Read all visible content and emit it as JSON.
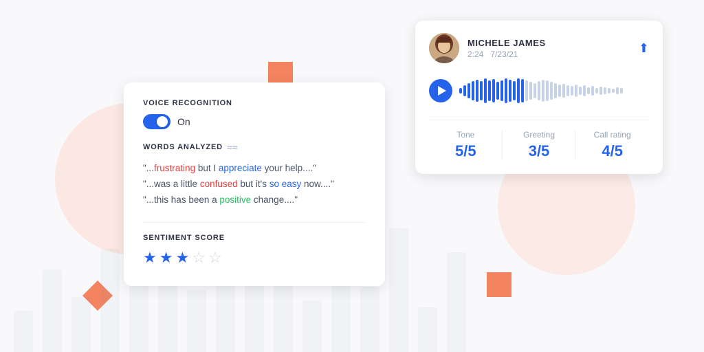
{
  "background": {
    "bars": [
      60,
      120,
      80,
      150,
      100,
      170,
      90,
      140,
      110,
      160,
      75,
      130,
      95,
      180,
      65,
      145
    ]
  },
  "voice_card": {
    "title": "VOICE RECOGNITION",
    "toggle_label": "On",
    "toggle_on": true,
    "words_analyzed_label": "WORDS ANALYZED",
    "quotes": [
      {
        "parts": [
          {
            "text": "\"..."
          },
          {
            "text": "frustrating",
            "class": "word-red"
          },
          {
            "text": " but I "
          },
          {
            "text": "appreciate",
            "class": "word-blue"
          },
          {
            "text": " your help....\""
          }
        ]
      },
      {
        "parts": [
          {
            "text": "\"...was a little "
          },
          {
            "text": "confused",
            "class": "word-red"
          },
          {
            "text": " but it's "
          },
          {
            "text": "so easy",
            "class": "word-blue"
          },
          {
            "text": " now....\""
          }
        ]
      },
      {
        "parts": [
          {
            "text": "\"...this has been a "
          },
          {
            "text": "positive",
            "class": "word-green"
          },
          {
            "text": " change....\""
          }
        ]
      }
    ],
    "sentiment_score_label": "SENTIMENT SCORE",
    "stars_filled": 3,
    "stars_total": 5
  },
  "audio_card": {
    "user_name": "MICHELE JAMES",
    "user_time": "2:24",
    "user_date": "7/23/21",
    "metrics": [
      {
        "label": "Tone",
        "value": "5/5"
      },
      {
        "label": "Greeting",
        "value": "3/5"
      },
      {
        "label": "Call rating",
        "value": "4/5"
      }
    ]
  }
}
